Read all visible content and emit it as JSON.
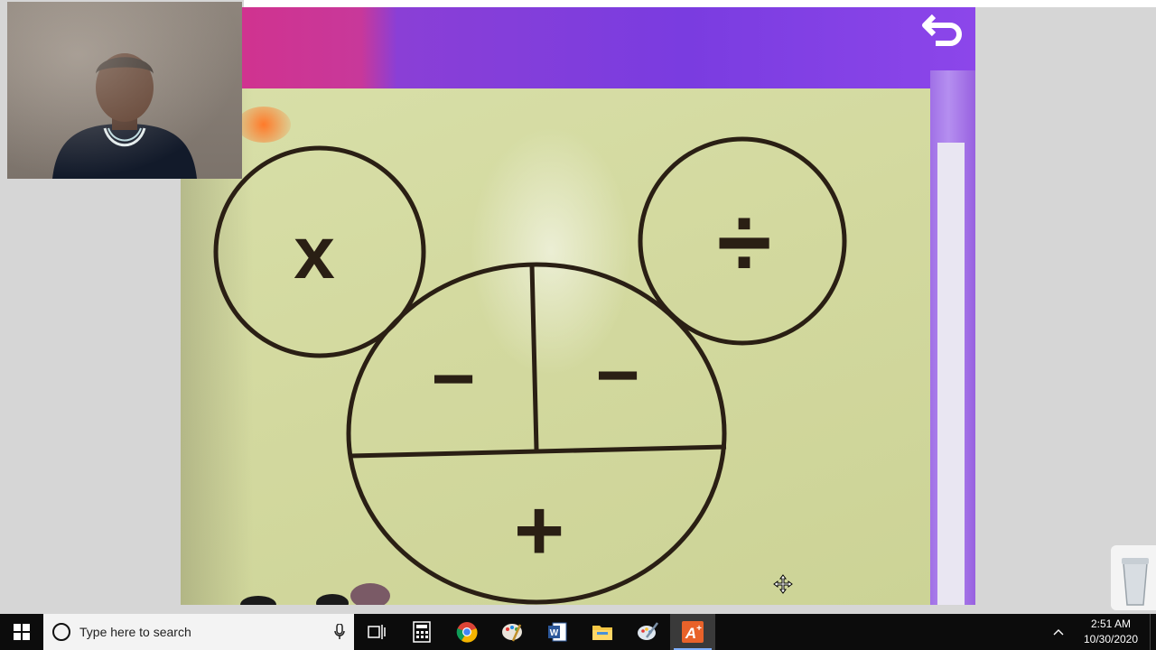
{
  "diagram": {
    "symbols": {
      "multiply": "x",
      "divide": "÷",
      "subtract_left": "−",
      "subtract_right": "−",
      "add": "+"
    }
  },
  "taskbar": {
    "search_placeholder": "Type here to search",
    "apps": [
      {
        "name": "task-view"
      },
      {
        "name": "calculator"
      },
      {
        "name": "chrome"
      },
      {
        "name": "paint"
      },
      {
        "name": "word"
      },
      {
        "name": "file-explorer"
      },
      {
        "name": "settings-tool"
      },
      {
        "name": "aplus-app",
        "active": true
      }
    ],
    "clock": {
      "time": "2:51 AM",
      "date": "10/30/2020"
    }
  },
  "colors": {
    "taskbar_bg": "#0c0c0c",
    "paper": "#d3d99f",
    "ink": "#2a1f14",
    "purple": "#8a3fd6",
    "magenta": "#d4308a"
  }
}
